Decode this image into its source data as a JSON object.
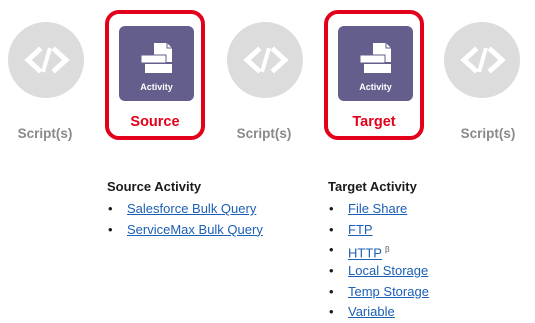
{
  "flow": {
    "script_label": "Script(s)",
    "source": {
      "tile_text": "Activity",
      "label": "Source"
    },
    "target": {
      "tile_text": "Activity",
      "label": "Target"
    }
  },
  "source_list": {
    "title": "Source Activity",
    "items": [
      {
        "label": "Salesforce Bulk Query"
      },
      {
        "label": "ServiceMax Bulk Query"
      }
    ]
  },
  "target_list": {
    "title": "Target Activity",
    "items": [
      {
        "label": "File Share"
      },
      {
        "label": "FTP"
      },
      {
        "label": "HTTP",
        "badge": "β"
      },
      {
        "label": "Local Storage"
      },
      {
        "label": "Temp Storage"
      },
      {
        "label": "Variable"
      }
    ]
  },
  "colors": {
    "highlight": "#e3001b",
    "activity_tile": "#645e8c",
    "script_circle": "#dcdcdc",
    "link": "#1c5fb6"
  }
}
